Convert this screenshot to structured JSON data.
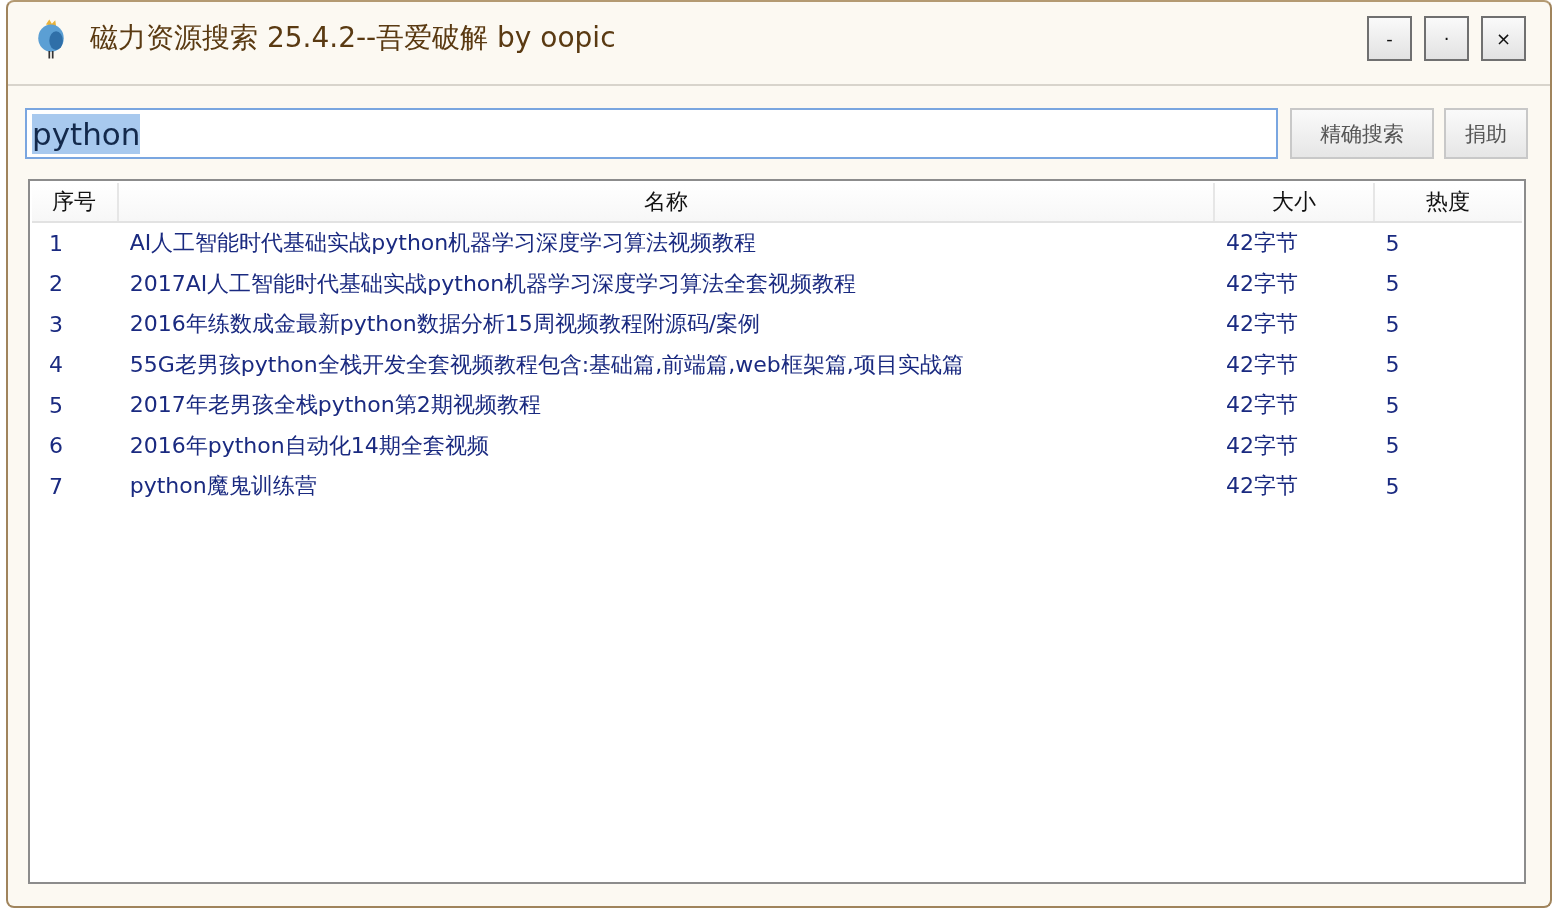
{
  "window": {
    "title": "磁力资源搜索 25.4.2--吾爱破解 by oopic",
    "controls": [
      "-",
      "·",
      "×"
    ]
  },
  "search": {
    "value": "python",
    "text_selected": true
  },
  "buttons": [
    "精确搜索",
    "捐助"
  ],
  "table": {
    "columns": [
      "序号",
      "名称",
      "大小",
      "热度"
    ],
    "rows": [
      [
        "1",
        "AI人工智能时代基础实战python机器学习深度学习算法视频教程",
        "42字节",
        "5"
      ],
      [
        "2",
        "2017AI人工智能时代基础实战python机器学习深度学习算法全套视频教程",
        "42字节",
        "5"
      ],
      [
        "3",
        "2016年练数成金最新python数据分析15周视频教程附源码/案例",
        "42字节",
        "5"
      ],
      [
        "4",
        "55G老男孩python全栈开发全套视频教程包含:基础篇,前端篇,web框架篇,项目实战篇",
        "42字节",
        "5"
      ],
      [
        "5",
        "2017年老男孩全栈python第2期视频教程",
        "42字节",
        "5"
      ],
      [
        "6",
        "2016年python自动化14期全套视频",
        "42字节",
        "5"
      ],
      [
        "7",
        "python魔鬼训练营",
        "42字节",
        "5"
      ]
    ]
  }
}
